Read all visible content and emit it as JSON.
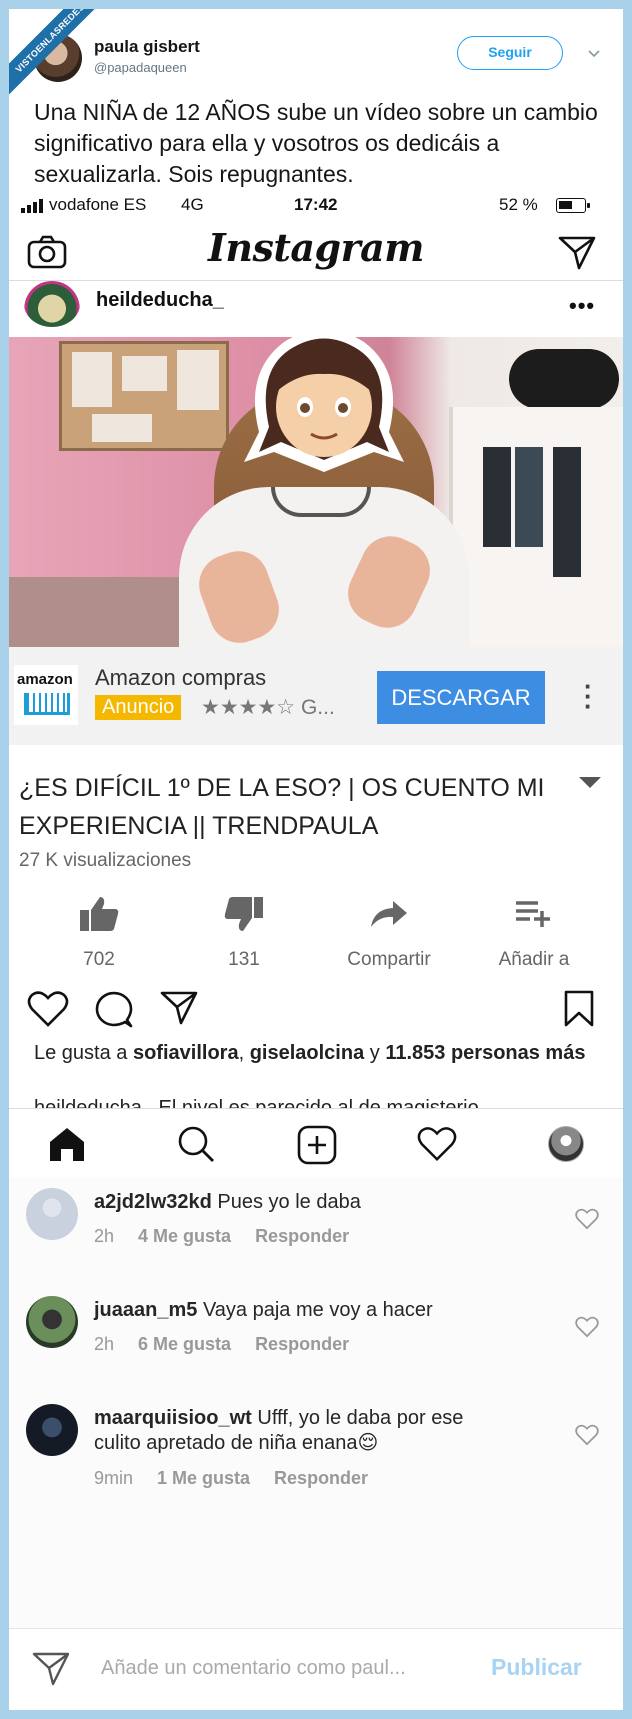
{
  "watermark": "VISTOENLASREDES",
  "tweet": {
    "name": "paula gisbert",
    "handle": "@papadaqueen",
    "follow_label": "Seguir",
    "text": "Una NIÑA de 12 AÑOS sube un vídeo sobre un cambio significativo para ella y vosotros os dedicáis a sexualizarla. Sois repugnantes."
  },
  "status_bar": {
    "carrier": "vodafone ES",
    "network": "4G",
    "time": "17:42",
    "battery": "52 %"
  },
  "instagram": {
    "logo": "Instagram",
    "post_user": "heildeducha_",
    "more": "•••",
    "likes_prefix": "Le gusta a ",
    "likes_user1": "sofiavillora",
    "likes_sep": ", ",
    "likes_user2": "giselaolcina",
    "likes_and": " y ",
    "likes_count": "11.853 personas más",
    "caption": "heildeducha_ El nivel es parecido al de magisterio"
  },
  "ad": {
    "brand": "amazon",
    "title": "Amazon compras",
    "badge": "Anuncio",
    "rating": "★★★★☆ G...",
    "cta": "DESCARGAR"
  },
  "video": {
    "title": "¿ES DIFÍCIL 1º DE LA ESO? | OS CUENTO MI EXPERIENCIA || TRENDPAULA",
    "views": "27 K visualizaciones",
    "actions": [
      {
        "label": "702",
        "icon": "thumbs-up-icon"
      },
      {
        "label": "131",
        "icon": "thumbs-down-icon"
      },
      {
        "label": "Compartir",
        "icon": "share-icon"
      },
      {
        "label": "Añadir a",
        "icon": "add-to-playlist-icon"
      }
    ]
  },
  "comments": [
    {
      "user": "a2jd2lw32kd",
      "text": " Pues yo le daba",
      "time": "2h",
      "likes": "4 Me gusta",
      "reply": "Responder"
    },
    {
      "user": "juaaan_m5",
      "text": " Vaya paja me voy a hacer",
      "time": "2h",
      "likes": "6 Me gusta",
      "reply": "Responder"
    },
    {
      "user": "maarquiisioo_wt",
      "text": " Ufff, yo le daba por ese culito apretado de niña enana😌",
      "time": "9min",
      "likes": "1 Me gusta",
      "reply": "Responder"
    }
  ],
  "composer": {
    "placeholder": "Añade un comentario como paul...",
    "publish": "Publicar"
  }
}
